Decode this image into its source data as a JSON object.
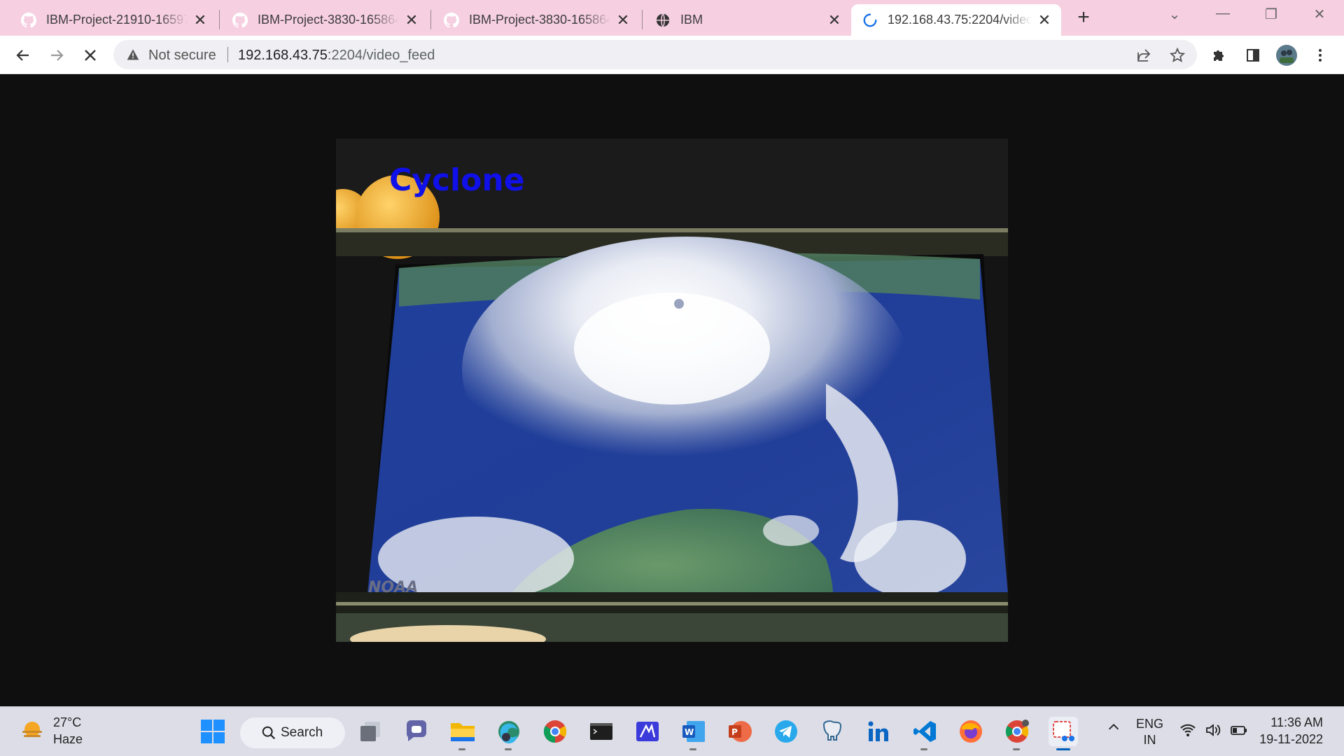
{
  "browser": {
    "tabs": [
      {
        "title": "IBM-Project-21910-16597",
        "icon": "github-icon",
        "active": false
      },
      {
        "title": "IBM-Project-3830-165864",
        "icon": "github-icon",
        "active": false
      },
      {
        "title": "IBM-Project-3830-165864",
        "icon": "github-icon",
        "active": false
      },
      {
        "title": "IBM",
        "icon": "globe-icon",
        "active": false
      },
      {
        "title": "192.168.43.75:2204/video",
        "icon": "loading-spinner-icon",
        "active": true
      }
    ],
    "new_tab_label": "+",
    "address_bar": {
      "security_label": "Not secure",
      "host": "192.168.43.75",
      "path": ":2204/video_feed"
    }
  },
  "video": {
    "overlay_label": "Cyclone",
    "watermark": "NOAA"
  },
  "taskbar": {
    "weather": {
      "temp": "27°C",
      "condition": "Haze"
    },
    "search_label": "Search",
    "tray": {
      "lang_top": "ENG",
      "lang_bottom": "IN"
    },
    "clock": {
      "time": "11:36 AM",
      "date": "19-11-2022"
    }
  },
  "colors": {
    "tab_strip": "#f6cfe0",
    "overlay_text": "#1010e8",
    "taskbar": "#dcdde7"
  }
}
